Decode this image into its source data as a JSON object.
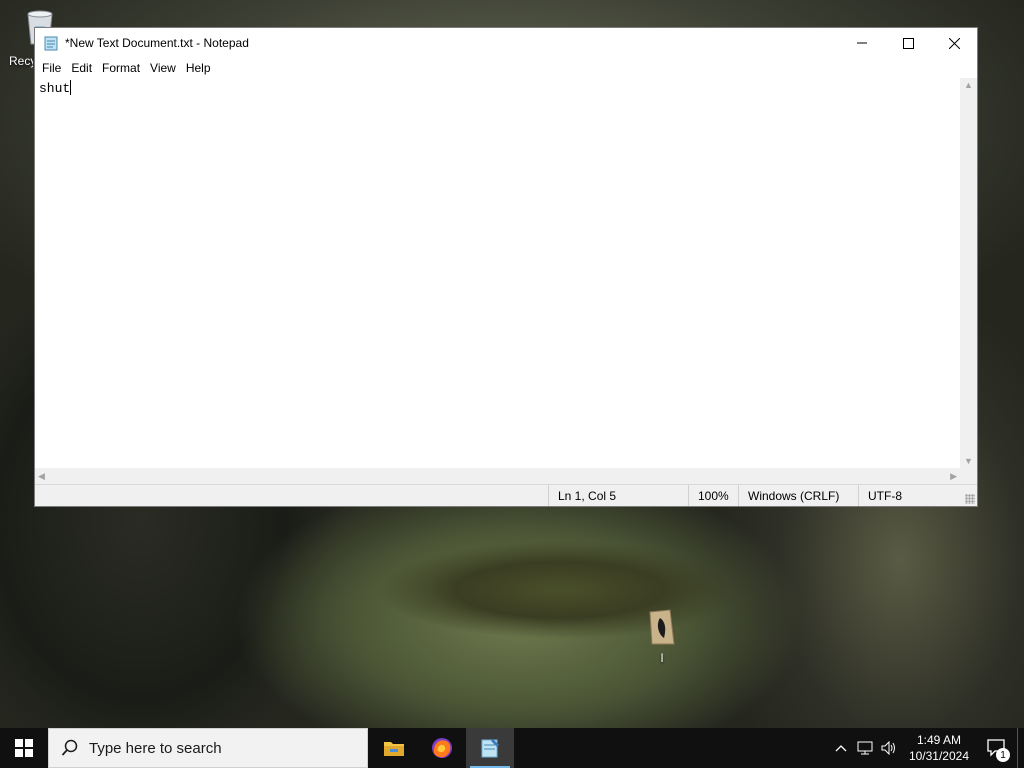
{
  "desktop": {
    "recycle_bin_label": "Recycle Bin",
    "folder_label": "I"
  },
  "window": {
    "title": "*New Text Document.txt - Notepad",
    "menu": [
      "File",
      "Edit",
      "Format",
      "View",
      "Help"
    ],
    "content": "shut",
    "status": {
      "position": "Ln 1, Col 5",
      "zoom": "100%",
      "line_ending": "Windows (CRLF)",
      "encoding": "UTF-8"
    }
  },
  "taskbar": {
    "search_placeholder": "Type here to search",
    "apps": [
      "file-explorer",
      "firefox",
      "notepad"
    ],
    "clock_time": "1:49 AM",
    "clock_date": "10/31/2024",
    "notification_count": "1"
  },
  "colors": {
    "taskbar": "#101010",
    "accent": "#76b9ed"
  }
}
